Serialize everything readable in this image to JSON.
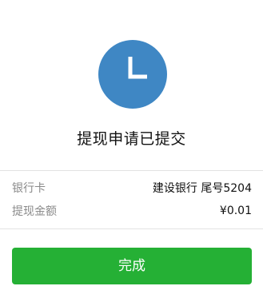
{
  "status": {
    "icon": "clock-icon",
    "icon_color": "#3f87c4",
    "title": "提现申请已提交"
  },
  "details": [
    {
      "label": "银行卡",
      "value": "建设银行 尾号5204"
    },
    {
      "label": "提现金额",
      "value": "¥0.01"
    }
  ],
  "actions": {
    "done_label": "完成",
    "done_color": "#25b035"
  }
}
